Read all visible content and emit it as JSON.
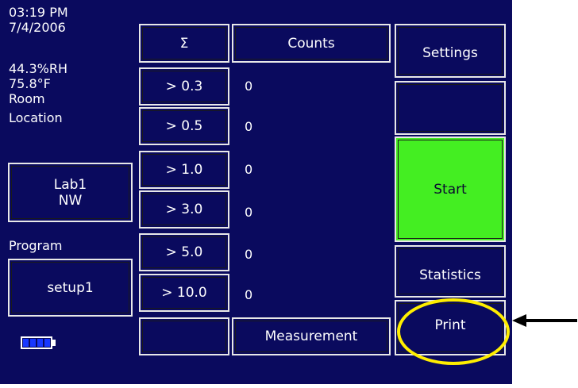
{
  "status": {
    "time": "03:19 PM",
    "date": "7/4/2006",
    "humidity": "44.3%RH",
    "temperature": "75.8°F",
    "room_label": "Room",
    "location_label": "Location",
    "location_line1": "Lab1",
    "location_line2": "NW",
    "program_label": "Program",
    "program_value": "setup1",
    "battery_level": 1.0
  },
  "grid": {
    "sigma_label": "Σ",
    "counts_header": "Counts",
    "measurement_label": "Measurement",
    "channels": [
      {
        "label": "> 0.3",
        "count": "0"
      },
      {
        "label": "> 0.5",
        "count": "0"
      },
      {
        "label": "> 1.0",
        "count": "0"
      },
      {
        "label": "> 3.0",
        "count": "0"
      },
      {
        "label": "> 5.0",
        "count": "0"
      },
      {
        "label": "> 10.0",
        "count": "0"
      }
    ]
  },
  "buttons": {
    "settings": "Settings",
    "blank": "",
    "start": "Start",
    "statistics": "Statistics",
    "print": "Print"
  },
  "colors": {
    "screen_bg": "#0a0a5e",
    "start_green": "#44ee22",
    "highlight_yellow": "#ffee00",
    "battery_blue": "#1838ff"
  }
}
